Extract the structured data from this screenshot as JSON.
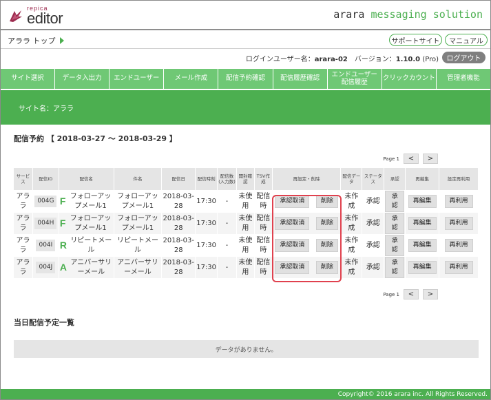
{
  "header": {
    "logo_sub": "repica",
    "logo_main": "editor",
    "brand_a": "arara",
    "brand_b": "messaging solution"
  },
  "breadcrumb": "アララ トップ",
  "top_buttons": {
    "support": "サポートサイト",
    "manual": "マニュアル"
  },
  "userline": {
    "prefix": "ログインユーザー名：",
    "user": "arara-02",
    "version_prefix": "　バージョン：",
    "version": "1.10.0",
    "version_suffix": " (Pro)"
  },
  "logout_label": "ログアウト",
  "nav": [
    "サイト選択",
    "データ入出力",
    "エンドユーザー",
    "メール作成",
    "配信予約確認",
    "配信履歴確認",
    "エンドユーザー\n配信履歴",
    "クリックカウント",
    "管理者機能"
  ],
  "site_name": "サイト名：アララ",
  "reservation_title": "配信予約 【 2018-03-27 ～ 2018-03-29 】",
  "pager": {
    "label": "Page 1",
    "prev": "<",
    "next": ">"
  },
  "table": {
    "headers": [
      "サービス",
      "配信ID",
      "配信名",
      "件名",
      "配信日",
      "配信時刻",
      "配信数\n(入力数)",
      "開封確認",
      "TSV作成",
      "再設定・削除",
      "配信データ",
      "ステータス",
      "承認",
      "再編集",
      "設定再利用"
    ],
    "rows": [
      {
        "service": "アララ",
        "id": "004G",
        "letter": "F",
        "name": "フォローアップメール1",
        "subject": "フォローアップメール1",
        "date": "2018-03-28",
        "time": "17:30",
        "count": "-",
        "open": "未使用",
        "tsv": "配信時",
        "btn_cancel": "承認取消",
        "btn_delete": "削除",
        "data": "未作成",
        "status": "承認",
        "approve": "承認",
        "edit": "再編集",
        "reuse": "再利用"
      },
      {
        "service": "アララ",
        "id": "004H",
        "letter": "F",
        "name": "フォローアップメール1",
        "subject": "フォローアップメール1",
        "date": "2018-03-28",
        "time": "17:30",
        "count": "-",
        "open": "未使用",
        "tsv": "配信時",
        "btn_cancel": "承認取消",
        "btn_delete": "削除",
        "data": "未作成",
        "status": "承認",
        "approve": "承認",
        "edit": "再編集",
        "reuse": "再利用"
      },
      {
        "service": "アララ",
        "id": "004I",
        "letter": "R",
        "name": "リピートメール",
        "subject": "リピートメール",
        "date": "2018-03-28",
        "time": "17:30",
        "count": "-",
        "open": "未使用",
        "tsv": "配信時",
        "btn_cancel": "承認取消",
        "btn_delete": "削除",
        "data": "未作成",
        "status": "承認",
        "approve": "承認",
        "edit": "再編集",
        "reuse": "再利用"
      },
      {
        "service": "アララ",
        "id": "004J",
        "letter": "A",
        "name": "アニバーサリーメール",
        "subject": "アニバーサリーメール",
        "date": "2018-03-28",
        "time": "17:30",
        "count": "-",
        "open": "未使用",
        "tsv": "配信時",
        "btn_cancel": "承認取消",
        "btn_delete": "削除",
        "data": "未作成",
        "status": "承認",
        "approve": "承認",
        "edit": "再編集",
        "reuse": "再利用"
      }
    ]
  },
  "today_title": "当日配信予定一覧",
  "no_data": "データがありません。",
  "footer": "Copyright© 2016 arara inc. All Rights Reserved.",
  "colors": {
    "accent": "#4caf50",
    "nav": "#6fc875",
    "highlight": "#e0414e",
    "logo": "#9c2a4e"
  }
}
